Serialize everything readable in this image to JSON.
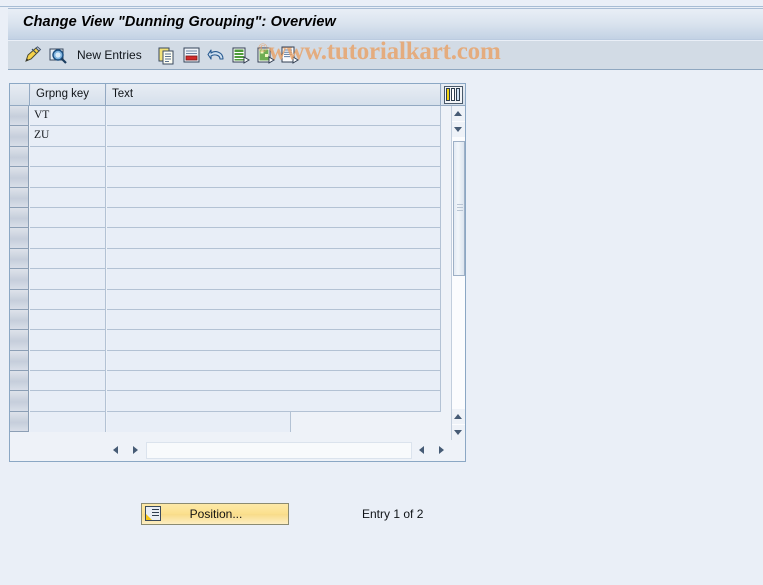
{
  "window": {
    "title": "Change View \"Dunning Grouping\": Overview"
  },
  "toolbar": {
    "new_entries_label": "New Entries",
    "icons": [
      "pencil-display-change-icon",
      "magnifier-display-icon",
      "copy-icon",
      "delete-row-icon",
      "undo-icon",
      "select-all-icon",
      "deselect-all-icon",
      "details-icon"
    ]
  },
  "watermark": {
    "copyright_mark": "©",
    "text": "www.tutorialkart.com",
    "color": "#e9a268"
  },
  "table": {
    "columns": [
      {
        "key": "grpng_key",
        "label": "Grpng key"
      },
      {
        "key": "text",
        "label": "Text"
      }
    ],
    "rows": [
      {
        "grpng_key": "VT",
        "text": ""
      },
      {
        "grpng_key": "ZU",
        "text": ""
      },
      {
        "grpng_key": "",
        "text": ""
      },
      {
        "grpng_key": "",
        "text": ""
      },
      {
        "grpng_key": "",
        "text": ""
      },
      {
        "grpng_key": "",
        "text": ""
      },
      {
        "grpng_key": "",
        "text": ""
      },
      {
        "grpng_key": "",
        "text": ""
      },
      {
        "grpng_key": "",
        "text": ""
      },
      {
        "grpng_key": "",
        "text": ""
      },
      {
        "grpng_key": "",
        "text": ""
      },
      {
        "grpng_key": "",
        "text": ""
      },
      {
        "grpng_key": "",
        "text": ""
      },
      {
        "grpng_key": "",
        "text": ""
      },
      {
        "grpng_key": "",
        "text": ""
      },
      {
        "grpng_key": "",
        "text": ""
      }
    ],
    "settings_icon": "table-settings-icon"
  },
  "scrollbars": {
    "vertical": {
      "up_icon": "arrow-up-icon",
      "down_icon": "arrow-down-icon",
      "page_up_icon": "arrow-up-icon",
      "page_down_icon": "arrow-down-icon"
    },
    "horizontal": {
      "left_icon": "arrow-left-icon",
      "right_icon": "arrow-right-icon",
      "left_icon_2": "arrow-left-icon",
      "right_icon_2": "arrow-right-icon"
    }
  },
  "footer": {
    "position_button_label": "Position...",
    "position_button_icon": "position-icon",
    "entry_status": "Entry 1 of 2"
  },
  "colors": {
    "title_bar": "#c3d2e4",
    "toolbar": "#d2dbe5",
    "page_background": "#eaeff7",
    "cell_background": "#e8eef7",
    "button_yellow": "#fbe08e"
  }
}
